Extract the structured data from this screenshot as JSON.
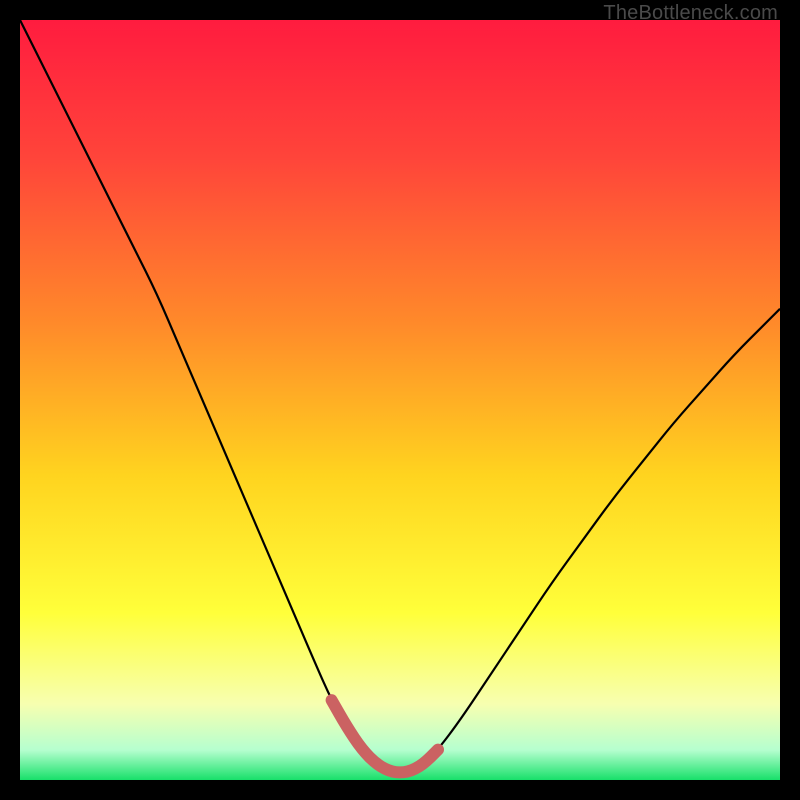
{
  "watermark": {
    "text": "TheBottleneck.com"
  },
  "chart_data": {
    "type": "line",
    "title": "",
    "xlabel": "",
    "ylabel": "",
    "xlim": [
      0,
      100
    ],
    "ylim": [
      0,
      100
    ],
    "background_gradient_stops": [
      {
        "pct": 0,
        "color": "#ff1c3f"
      },
      {
        "pct": 18,
        "color": "#ff443a"
      },
      {
        "pct": 40,
        "color": "#ff8a2a"
      },
      {
        "pct": 60,
        "color": "#ffd41f"
      },
      {
        "pct": 78,
        "color": "#ffff3a"
      },
      {
        "pct": 90,
        "color": "#f7ffb0"
      },
      {
        "pct": 96,
        "color": "#b6ffcf"
      },
      {
        "pct": 100,
        "color": "#18e06a"
      }
    ],
    "green_band": {
      "top_pct": 96,
      "bottom_pct": 100,
      "top_color": "#b6ffcf",
      "bottom_color": "#18e06a"
    },
    "series": [
      {
        "name": "bottleneck-curve",
        "color": "#000000",
        "width": 2.2,
        "x": [
          0,
          3,
          6,
          9,
          12,
          15,
          18,
          21,
          24,
          27,
          30,
          33,
          36,
          39,
          41,
          43,
          45,
          47,
          49,
          51,
          53,
          55,
          58,
          62,
          66,
          70,
          74,
          78,
          82,
          86,
          90,
          94,
          98,
          100
        ],
        "y": [
          0,
          6,
          12,
          18,
          24,
          30,
          36,
          43,
          50,
          57,
          64,
          71,
          78,
          85,
          89.5,
          93,
          96,
          98,
          99,
          99,
          98,
          96,
          92,
          86,
          80,
          74,
          68.5,
          63,
          58,
          53,
          48.5,
          44,
          40,
          38
        ]
      },
      {
        "name": "highlight-valley",
        "color": "#cb6262",
        "width": 12,
        "linecap": "round",
        "x": [
          41,
          43,
          45,
          47,
          49,
          51,
          53,
          55
        ],
        "y": [
          89.5,
          93,
          96,
          98,
          99,
          99,
          98,
          96
        ]
      }
    ]
  }
}
